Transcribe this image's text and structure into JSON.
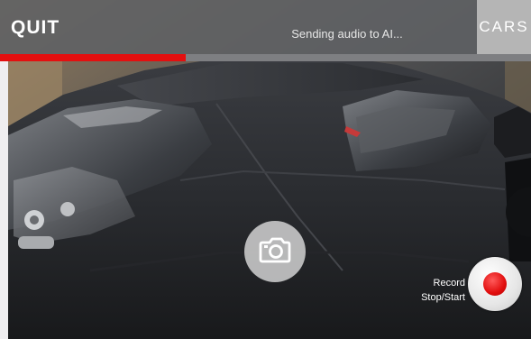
{
  "header": {
    "quit_label": "QUIT",
    "status_text": "Sending audio to AI...",
    "cars_label": "CARS"
  },
  "progress": {
    "fraction": 0.35
  },
  "controls": {
    "camera_icon": "camera-icon",
    "record_label_line1": "Record",
    "record_label_line2": "Stop/Start"
  },
  "colors": {
    "accent_red": "#e40f0f",
    "topbar": "#5f6164",
    "cars_button": "#b5b5b5",
    "car_body": "#2b2d31"
  }
}
